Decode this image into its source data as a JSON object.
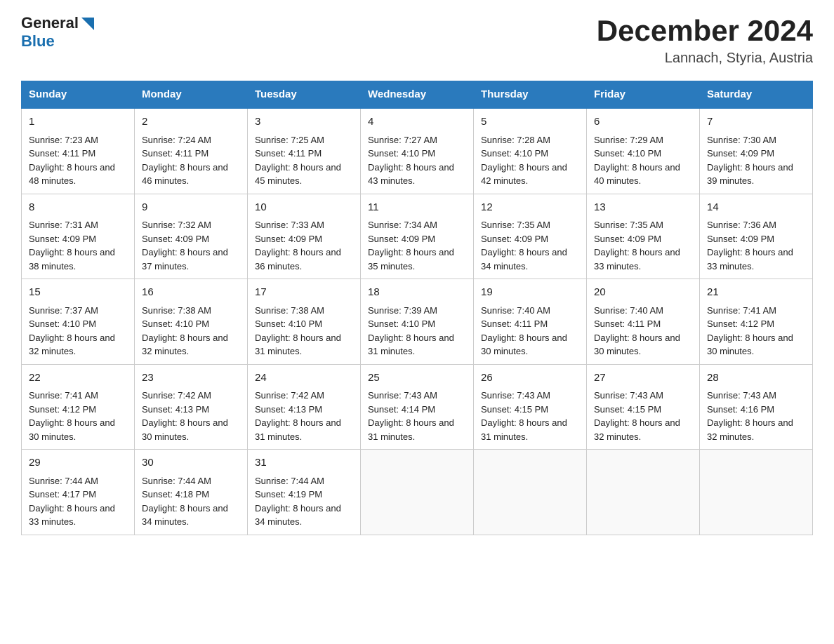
{
  "header": {
    "logo_line1": "General",
    "logo_line2": "Blue",
    "title": "December 2024",
    "subtitle": "Lannach, Styria, Austria"
  },
  "calendar": {
    "headers": [
      "Sunday",
      "Monday",
      "Tuesday",
      "Wednesday",
      "Thursday",
      "Friday",
      "Saturday"
    ],
    "weeks": [
      [
        {
          "day": "1",
          "sunrise": "7:23 AM",
          "sunset": "4:11 PM",
          "daylight": "8 hours and 48 minutes."
        },
        {
          "day": "2",
          "sunrise": "7:24 AM",
          "sunset": "4:11 PM",
          "daylight": "8 hours and 46 minutes."
        },
        {
          "day": "3",
          "sunrise": "7:25 AM",
          "sunset": "4:11 PM",
          "daylight": "8 hours and 45 minutes."
        },
        {
          "day": "4",
          "sunrise": "7:27 AM",
          "sunset": "4:10 PM",
          "daylight": "8 hours and 43 minutes."
        },
        {
          "day": "5",
          "sunrise": "7:28 AM",
          "sunset": "4:10 PM",
          "daylight": "8 hours and 42 minutes."
        },
        {
          "day": "6",
          "sunrise": "7:29 AM",
          "sunset": "4:10 PM",
          "daylight": "8 hours and 40 minutes."
        },
        {
          "day": "7",
          "sunrise": "7:30 AM",
          "sunset": "4:09 PM",
          "daylight": "8 hours and 39 minutes."
        }
      ],
      [
        {
          "day": "8",
          "sunrise": "7:31 AM",
          "sunset": "4:09 PM",
          "daylight": "8 hours and 38 minutes."
        },
        {
          "day": "9",
          "sunrise": "7:32 AM",
          "sunset": "4:09 PM",
          "daylight": "8 hours and 37 minutes."
        },
        {
          "day": "10",
          "sunrise": "7:33 AM",
          "sunset": "4:09 PM",
          "daylight": "8 hours and 36 minutes."
        },
        {
          "day": "11",
          "sunrise": "7:34 AM",
          "sunset": "4:09 PM",
          "daylight": "8 hours and 35 minutes."
        },
        {
          "day": "12",
          "sunrise": "7:35 AM",
          "sunset": "4:09 PM",
          "daylight": "8 hours and 34 minutes."
        },
        {
          "day": "13",
          "sunrise": "7:35 AM",
          "sunset": "4:09 PM",
          "daylight": "8 hours and 33 minutes."
        },
        {
          "day": "14",
          "sunrise": "7:36 AM",
          "sunset": "4:09 PM",
          "daylight": "8 hours and 33 minutes."
        }
      ],
      [
        {
          "day": "15",
          "sunrise": "7:37 AM",
          "sunset": "4:10 PM",
          "daylight": "8 hours and 32 minutes."
        },
        {
          "day": "16",
          "sunrise": "7:38 AM",
          "sunset": "4:10 PM",
          "daylight": "8 hours and 32 minutes."
        },
        {
          "day": "17",
          "sunrise": "7:38 AM",
          "sunset": "4:10 PM",
          "daylight": "8 hours and 31 minutes."
        },
        {
          "day": "18",
          "sunrise": "7:39 AM",
          "sunset": "4:10 PM",
          "daylight": "8 hours and 31 minutes."
        },
        {
          "day": "19",
          "sunrise": "7:40 AM",
          "sunset": "4:11 PM",
          "daylight": "8 hours and 30 minutes."
        },
        {
          "day": "20",
          "sunrise": "7:40 AM",
          "sunset": "4:11 PM",
          "daylight": "8 hours and 30 minutes."
        },
        {
          "day": "21",
          "sunrise": "7:41 AM",
          "sunset": "4:12 PM",
          "daylight": "8 hours and 30 minutes."
        }
      ],
      [
        {
          "day": "22",
          "sunrise": "7:41 AM",
          "sunset": "4:12 PM",
          "daylight": "8 hours and 30 minutes."
        },
        {
          "day": "23",
          "sunrise": "7:42 AM",
          "sunset": "4:13 PM",
          "daylight": "8 hours and 30 minutes."
        },
        {
          "day": "24",
          "sunrise": "7:42 AM",
          "sunset": "4:13 PM",
          "daylight": "8 hours and 31 minutes."
        },
        {
          "day": "25",
          "sunrise": "7:43 AM",
          "sunset": "4:14 PM",
          "daylight": "8 hours and 31 minutes."
        },
        {
          "day": "26",
          "sunrise": "7:43 AM",
          "sunset": "4:15 PM",
          "daylight": "8 hours and 31 minutes."
        },
        {
          "day": "27",
          "sunrise": "7:43 AM",
          "sunset": "4:15 PM",
          "daylight": "8 hours and 32 minutes."
        },
        {
          "day": "28",
          "sunrise": "7:43 AM",
          "sunset": "4:16 PM",
          "daylight": "8 hours and 32 minutes."
        }
      ],
      [
        {
          "day": "29",
          "sunrise": "7:44 AM",
          "sunset": "4:17 PM",
          "daylight": "8 hours and 33 minutes."
        },
        {
          "day": "30",
          "sunrise": "7:44 AM",
          "sunset": "4:18 PM",
          "daylight": "8 hours and 34 minutes."
        },
        {
          "day": "31",
          "sunrise": "7:44 AM",
          "sunset": "4:19 PM",
          "daylight": "8 hours and 34 minutes."
        },
        null,
        null,
        null,
        null
      ]
    ]
  }
}
